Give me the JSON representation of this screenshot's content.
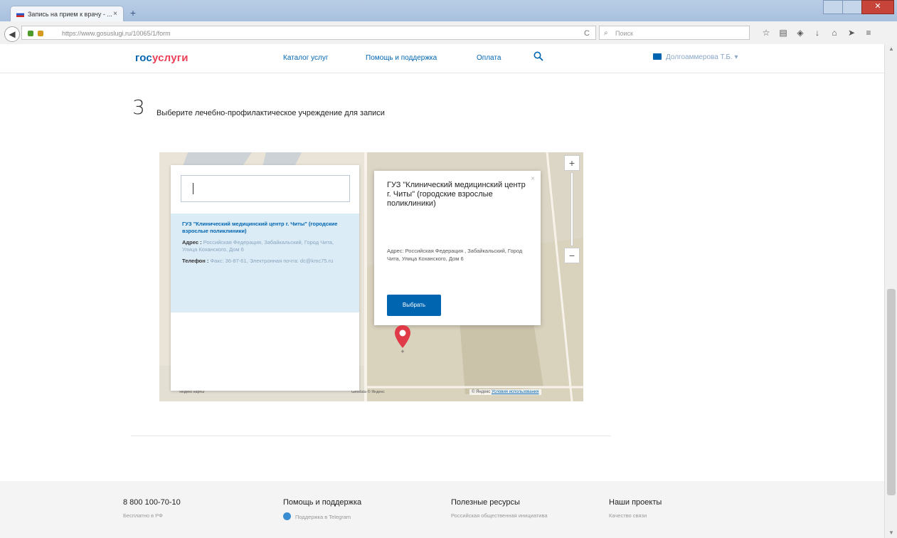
{
  "browser": {
    "tab_title": "Запись на прием к врачу - ...",
    "tab_close": "×",
    "new_tab": "+",
    "url": "https://www.gosuslugi.ru/10065/1/form",
    "search_placeholder": "Поиск",
    "back": "◀",
    "reload": "C",
    "close_window": "✕"
  },
  "header": {
    "logo_part1": "гос",
    "logo_part2": "услуги",
    "nav": [
      "Каталог услуг",
      "Помощь и поддержка",
      "Оплата"
    ],
    "user": "Долгоаммерова Т.Б. ▾"
  },
  "step": {
    "number": "3",
    "title": "Выберите лечебно-профилактическое учреждение для записи"
  },
  "list": {
    "search_value": "",
    "item": {
      "name": "ГУЗ \"Клинический медицинский центр г. Читы\" (городские взрослые поликлиники)",
      "address_label": "Адрес :",
      "address": "Российская Федерация, Забайкальский, Город Чита, Улица Коханского, Дом 6",
      "phone_label": "Телефон :",
      "phone": "Факс: 36-87-61, Электронная почта: dc@kmc75.ru"
    }
  },
  "popup": {
    "title": "ГУЗ \"Клинический медицинский центр г. Читы\" (городские взрослые поликлиники)",
    "address": "Адрес: Российская Федерация , Забайкальский, Город Чита, Улица Коханского, Дом 6",
    "button": "Выбрать",
    "close": "×"
  },
  "map": {
    "zoom_in": "+",
    "zoom_out": "−",
    "attribution": "© Яндекс",
    "terms": "Условия использования",
    "label_small": "Яндекс карты",
    "label_data": "Geodata © Яндекс"
  },
  "footer": {
    "phone": "8 800 100-70-10",
    "phone_sub": "Бесплатно в РФ",
    "col2_title": "Помощь и поддержка",
    "col2_item": "Поддержка в Telegram",
    "col3_title": "Полезные ресурсы",
    "col3_item": "Российская общественная инициатива",
    "col4_title": "Наши проекты",
    "col4_item": "Качество связи"
  },
  "colors": {
    "brand_blue": "#0065b1",
    "brand_red": "#ee3f58",
    "pin_red": "#e03a48"
  }
}
